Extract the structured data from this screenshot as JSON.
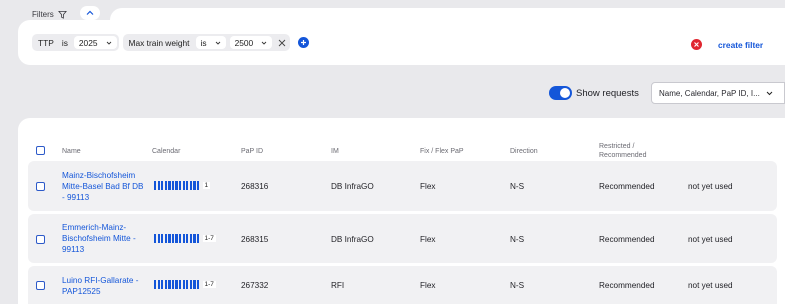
{
  "filters": {
    "label": "Filters",
    "chips": [
      {
        "field": "TTP",
        "operator": "is",
        "value": "2025"
      },
      {
        "field": "Max train weight",
        "operator": "is",
        "value": "2500"
      }
    ],
    "create_filter_label": "create filter"
  },
  "toolbar": {
    "show_requests_label": "Show requests",
    "show_requests_on": true,
    "search_placeholder": "Name, Calendar, PaP ID, I..."
  },
  "table": {
    "columns": [
      "Name",
      "Calendar",
      "PaP ID",
      "IM",
      "Fix / Flex PaP",
      "Direction",
      "Restricted / Recommended"
    ],
    "rows": [
      {
        "name": "Mainz-Bischofsheim Mitte-Basel Bad Bf DB - 99113",
        "calendar_label": "1",
        "pap_id": "268316",
        "im": "DB InfraGO",
        "fix_flex": "Flex",
        "direction": "N-S",
        "restricted": "Recommended",
        "status": "not yet used"
      },
      {
        "name": "Emmerich-Mainz-Bischofsheim Mitte - 99113",
        "calendar_label": "1-7",
        "pap_id": "268315",
        "im": "DB InfraGO",
        "fix_flex": "Flex",
        "direction": "N-S",
        "restricted": "Recommended",
        "status": "not yet used"
      },
      {
        "name": "Luino RFI-Gallarate - PAP12525",
        "calendar_label": "1-7",
        "pap_id": "267332",
        "im": "RFI",
        "fix_flex": "Flex",
        "direction": "N-S",
        "restricted": "Recommended",
        "status": "not yet used"
      }
    ]
  },
  "colors": {
    "accent": "#1456d9",
    "danger": "#e0262f",
    "background": "#e9e9ec"
  }
}
